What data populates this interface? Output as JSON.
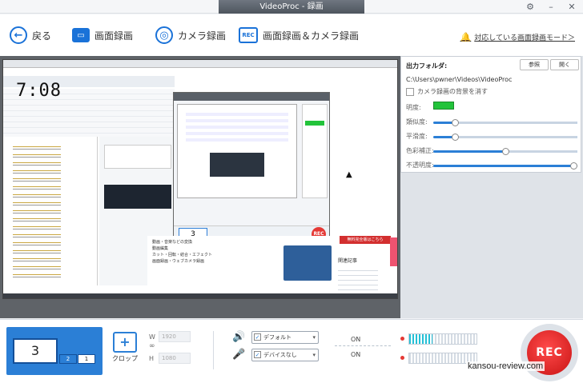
{
  "window": {
    "title": "VideoProc - 録画"
  },
  "toolbar": {
    "back_label": "戻る",
    "screen_label": "画面録画",
    "camera_label": "カメラ録画",
    "both_label": "画面録画＆カメラ録画",
    "rec_icon_text": "REC",
    "modes_link": "対応している画面録画モード＞"
  },
  "preview": {
    "clock": "7:08",
    "nested_count": "3",
    "nested_rec": "REC",
    "article_lines": [
      "動画・音楽などの変換",
      "動画編集",
      "カット・回転・結合・エフェクト",
      "画面録画・ウェブカメラ録画"
    ],
    "side_banner": "無料完全版はこちら",
    "side_heading": "関連記事"
  },
  "output": {
    "header": "出力フォルダ:",
    "browse_label": "参照",
    "open_label": "開く",
    "path": "C:\\Users\\pwner\\Videos\\VideoProc",
    "erase_camera_bg": "カメラ録画の背景を消す",
    "brightness_label": "明度:",
    "similarity_label": "類似度:",
    "smoothness_label": "平滑度:",
    "color_correction_label": "色彩補正:",
    "opacity_label": "不透明度:",
    "brightness_color": "#22c33a",
    "similarity_value": 0.15,
    "smoothness_value": 0.15,
    "color_correction_value": 0.5,
    "opacity_value": 1.0
  },
  "controls": {
    "selected_screen": "3",
    "screen_2": "2",
    "screen_1": "1",
    "crop_label": "クロップ",
    "w_label": "W",
    "h_label": "H",
    "width_value": "1920",
    "height_value": "1080",
    "speaker_device": "デフォルト",
    "mic_device": "デバイスなし",
    "speaker_state": "ON",
    "mic_state": "ON",
    "speaker_level": 0.35,
    "mic_level": 0.0,
    "rec_label": "REC"
  },
  "watermark": "kansou-review.com"
}
